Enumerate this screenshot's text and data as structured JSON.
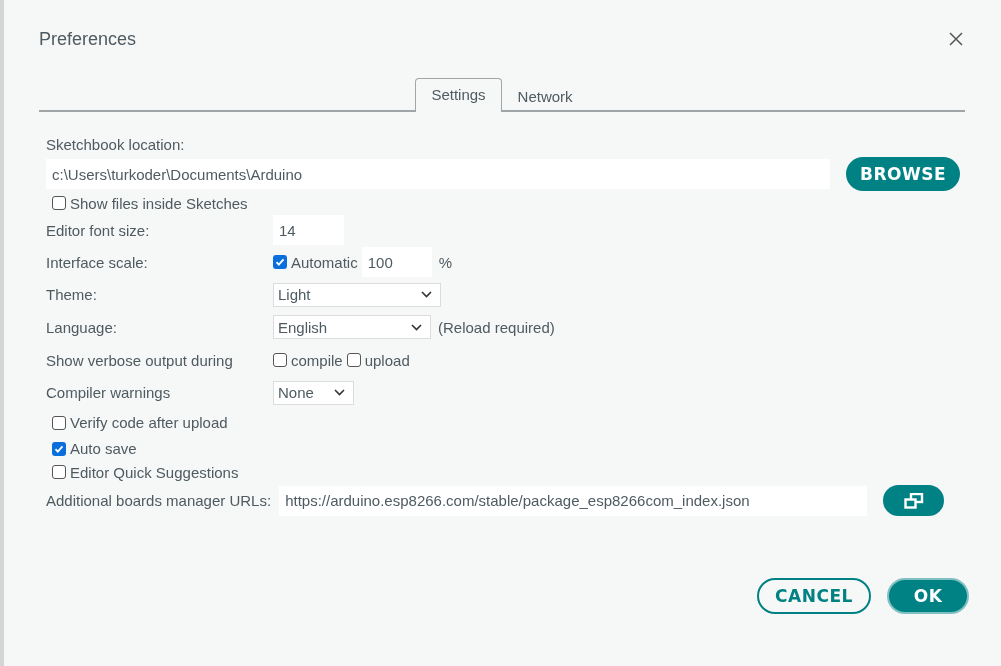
{
  "window": {
    "title": "Preferences"
  },
  "tabs": [
    {
      "label": "Settings",
      "selected": true
    },
    {
      "label": "Network",
      "selected": false
    }
  ],
  "sketchbook": {
    "label": "Sketchbook location:",
    "value": "c:\\Users\\turkoder\\Documents\\Arduino",
    "button": "BROWSE"
  },
  "show_files": {
    "label": "Show files inside Sketches",
    "checked": false
  },
  "rows": [
    {
      "kind": "number",
      "label": "Editor font size:",
      "value": "14"
    },
    {
      "kind": "scale",
      "label": "Interface scale:",
      "check": {
        "label": "Automatic",
        "checked": true
      },
      "value": "100",
      "unit": "%"
    },
    {
      "kind": "select",
      "label": "Theme:",
      "value": "Light"
    },
    {
      "kind": "select",
      "label": "Language:",
      "value": "English",
      "note": "(Reload required)"
    },
    {
      "kind": "checks",
      "label": "Show verbose output during",
      "options": [
        {
          "label": "compile",
          "checked": false
        },
        {
          "label": "upload",
          "checked": false
        }
      ]
    },
    {
      "kind": "select",
      "label": "Compiler warnings",
      "value": "None"
    }
  ],
  "checkboxes": [
    {
      "label": "Verify code after upload",
      "checked": false
    },
    {
      "label": "Auto save",
      "checked": true
    },
    {
      "label": "Editor Quick Suggestions",
      "checked": false
    }
  ],
  "boards_urls": {
    "label": "Additional boards manager URLs:",
    "value": "https://arduino.esp8266.com/stable/package_esp8266com_index.json"
  },
  "buttons": [
    {
      "label": "CANCEL",
      "kind": "secondary"
    },
    {
      "label": "OK",
      "kind": "primary"
    }
  ]
}
